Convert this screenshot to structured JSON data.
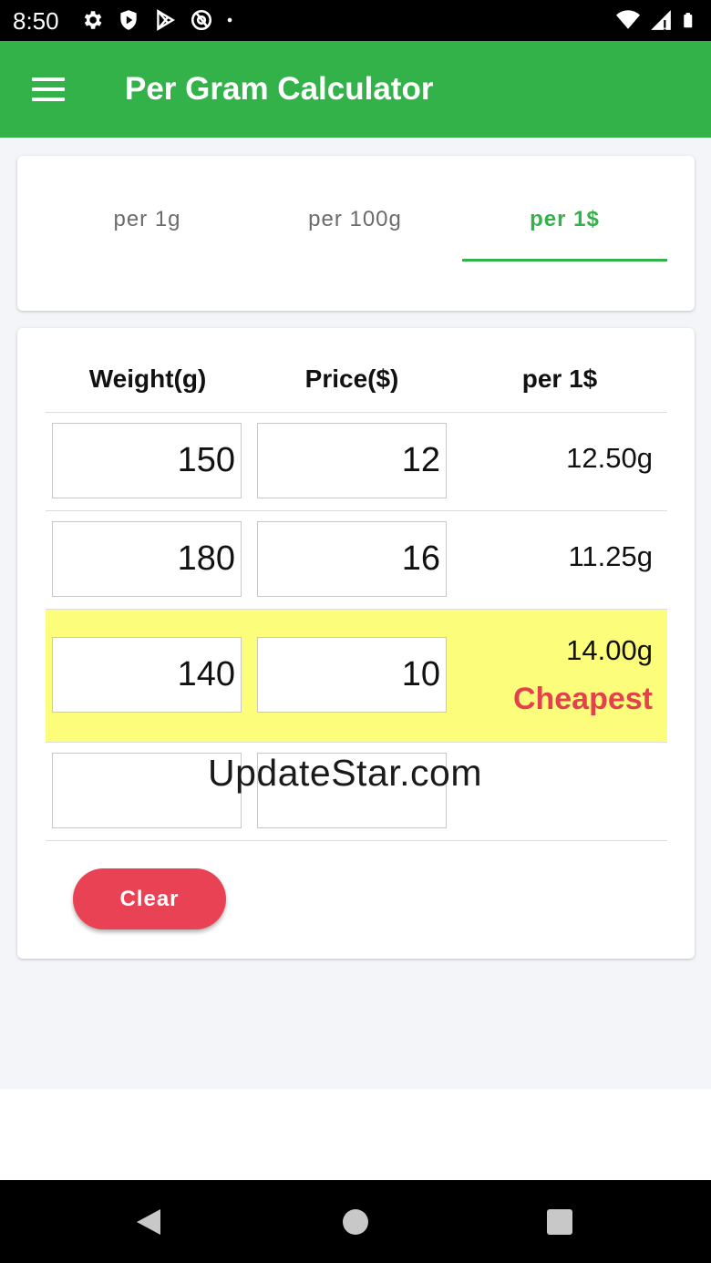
{
  "status_bar": {
    "time": "8:50",
    "left_icons": [
      "gear-icon",
      "shield-icon",
      "play-store-icon",
      "at-icon",
      "dot-icon"
    ],
    "right_icons": [
      "wifi-icon",
      "signal-icon",
      "battery-icon"
    ]
  },
  "app_bar": {
    "title": "Per Gram Calculator",
    "menu_icon": "hamburger-menu-icon"
  },
  "tabs": [
    {
      "label": "per 1g",
      "active": false
    },
    {
      "label": "per 100g",
      "active": false
    },
    {
      "label": "per 1$",
      "active": true
    }
  ],
  "table": {
    "headers": [
      "Weight(g)",
      "Price($)",
      "per 1$"
    ],
    "rows": [
      {
        "weight": "150",
        "price": "12",
        "result": "12.50g",
        "badge": ""
      },
      {
        "weight": "180",
        "price": "16",
        "result": "11.25g",
        "badge": ""
      },
      {
        "weight": "140",
        "price": "10",
        "result": "14.00g",
        "badge": "Cheapest"
      },
      {
        "weight": "",
        "price": "",
        "result": "",
        "badge": ""
      }
    ]
  },
  "clear_label": "Clear",
  "watermark": "UpdateStar.com",
  "colors": {
    "primary": "#34b24a",
    "highlight": "#fdfd7c",
    "accent_red": "#ea4255",
    "cheapest_text": "#e4404e"
  },
  "nav_bar": [
    "back-icon",
    "home-icon",
    "recents-icon"
  ]
}
